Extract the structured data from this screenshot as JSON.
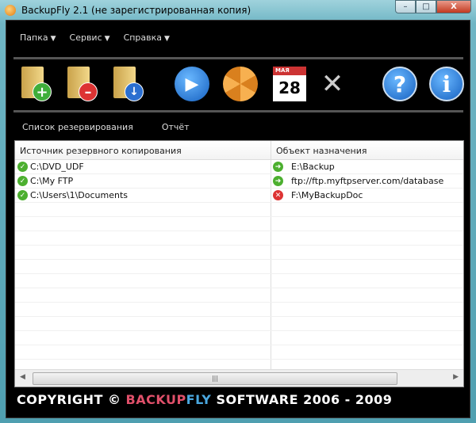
{
  "window": {
    "title": "BackupFly 2.1 (не зарегистрированная копия)",
    "minimize": "–",
    "maximize": "□",
    "close": "X"
  },
  "menu": [
    {
      "label": "Папка"
    },
    {
      "label": "Сервис"
    },
    {
      "label": "Справка"
    }
  ],
  "toolbar": {
    "calendar_month": "МАЯ",
    "calendar_day": "28"
  },
  "tabs": [
    {
      "label": "Список резервирования"
    },
    {
      "label": "Отчёт"
    }
  ],
  "table": {
    "columns": [
      "Источник резервного копирования",
      "Объект назначения"
    ],
    "rows": [
      {
        "source": "C:\\DVD_UDF",
        "destination": "E:\\Backup",
        "status": "ok"
      },
      {
        "source": "C:\\My FTP",
        "destination": "ftp://ftp.myftpserver.com/database",
        "status": "ok"
      },
      {
        "source": "C:\\Users\\1\\Documents",
        "destination": "F:\\MyBackupDoc",
        "status": "error"
      }
    ]
  },
  "footer": {
    "prefix": "COPYRIGHT © ",
    "brand1": "BACKUP",
    "brand2": "FLY",
    "suffix": " SOFTWARE 2006 - 2009",
    "brand1_color": "#e0506a",
    "brand2_color": "#4aa8e0"
  }
}
